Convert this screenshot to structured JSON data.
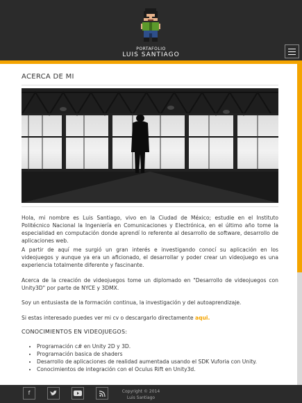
{
  "header": {
    "subtitle": "PORTAFOLIO",
    "title": "LUIS SANTIAGO"
  },
  "about": {
    "heading": "ACERCA DE MI",
    "paragraphs": [
      "Hola, mi nombre es Luis Santiago, vivo en la Ciudad de México; estudie en el Instituto Politécnico Nacional la Ingeniería en Comunicaciones y Electrónica, en el último año tome la especialidad en computación donde aprendí lo referente al desarrollo de software, desarrollo de aplicaciones web.",
      "A partir de aquí me surgió un gran interés e investigando conocí su aplicación en los videojuegos y aunque ya era un aficionado, el desarrollar y poder crear un videojuego es una experiencia totalmente diferente y fascinante.",
      "Acerca de la creación de videojuegos tome un diplomado en \"Desarrollo de videojuegos con Unity3D\" por parte de NYCE y 3DMX.",
      "Soy un entusiasta de la formación continua, la investigación y del autoaprendizaje."
    ],
    "cv_text": "Si estas interesado puedes ver mi cv o descargarlo directamente",
    "cv_link": "aqui.",
    "skills_heading": "CONOCIMIENTOS EN VIDEOJUEGOS:",
    "skills": [
      "Programación c# en Unity 2D y 3D.",
      "Programación basica de shaders",
      "Desarrollo de aplicaciones de realidad aumentada usando el SDK Vuforia con Unity.",
      "Conocimientos de integración con el Oculus Rift en Unity3d."
    ]
  },
  "footer": {
    "copyright_line1": "Copyright © 2014",
    "copyright_line2": "Luis Santiago"
  },
  "icons": {
    "menu": "hamburger-icon",
    "social": [
      "facebook-icon",
      "twitter-icon",
      "youtube-icon",
      "rss-icon"
    ]
  },
  "colors": {
    "accent": "#f4a400",
    "background": "#2b2b2b"
  }
}
